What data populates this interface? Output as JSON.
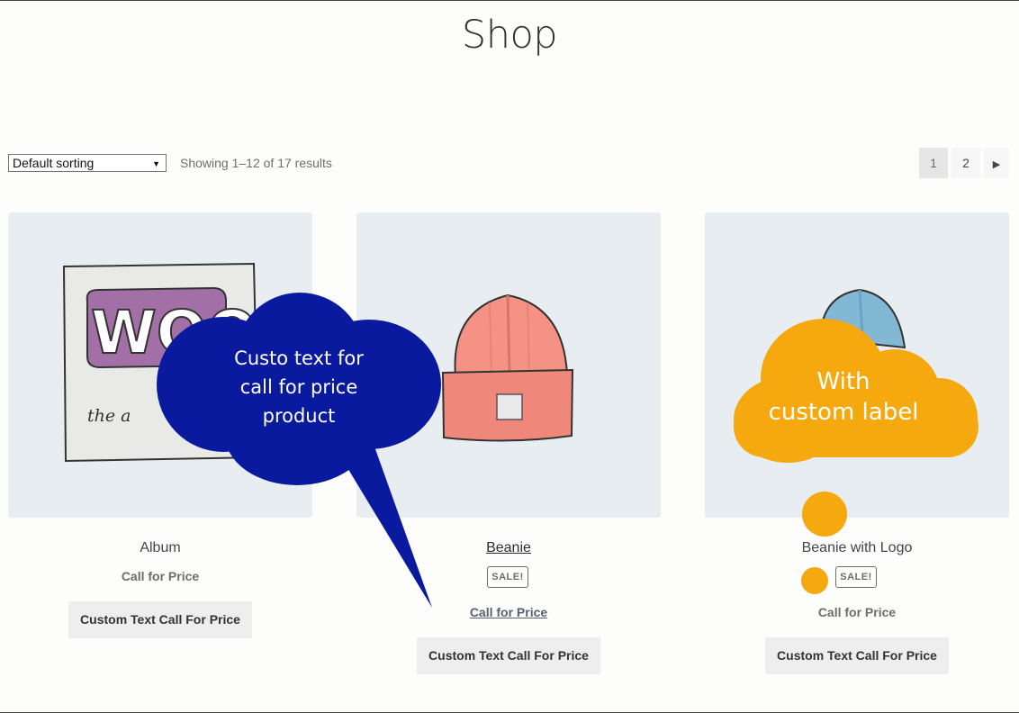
{
  "page": {
    "title": "Shop"
  },
  "toolbar": {
    "sorting": "Default sorting",
    "result_count": "Showing 1–12 of 17 results",
    "pages": [
      "1",
      "2"
    ],
    "next_icon": "caret-right-icon"
  },
  "products": [
    {
      "name": "Album",
      "price": "Call for Price",
      "button": "Custom Text Call For Price",
      "image_icon": "woo-album-image"
    },
    {
      "name": "Beanie",
      "sale": "SALE!",
      "price": "Call for Price",
      "button": "Custom Text Call For Price",
      "image_icon": "beanie-image"
    },
    {
      "name": "Beanie with Logo",
      "sale": "SALE!",
      "price": "Call for Price",
      "button": "Custom Text Call For Price",
      "image_icon": "beanie-logo-image"
    }
  ],
  "album_art": {
    "logo": "WOO",
    "script": "the a"
  },
  "callouts": {
    "blue": {
      "lines": [
        "Custo text for",
        "call for price",
        "product"
      ],
      "color": "#0a1a9e"
    },
    "orange": {
      "lines": [
        "With",
        "custom label"
      ],
      "color": "#f5a90f"
    }
  }
}
